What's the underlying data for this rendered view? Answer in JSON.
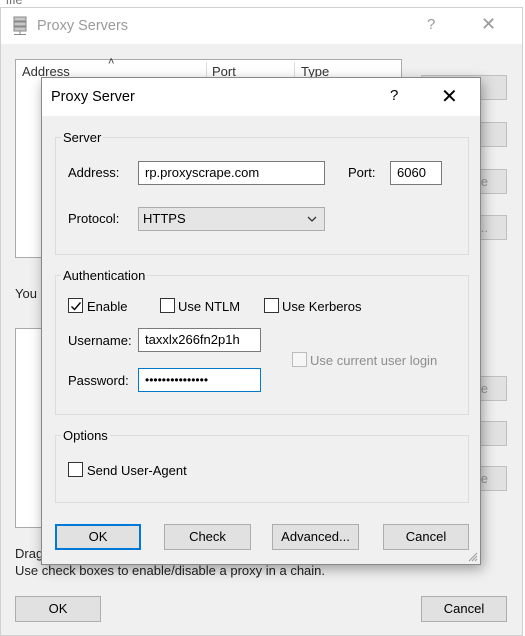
{
  "background": {
    "top_text": "ifie",
    "window": {
      "title": "Proxy Servers",
      "help_glyph": "?",
      "close_glyph": "✕",
      "columns": [
        "Address",
        "Port",
        "Type"
      ],
      "sort_glyph": "˄",
      "partial_text_you": "You c",
      "side_buttons": [
        "",
        "",
        "e",
        "..",
        "",
        "e",
        "",
        "e"
      ],
      "drag_text": "Drag",
      "hint_text": "Use check boxes to enable/disable a proxy in a chain.",
      "ok_label": "OK",
      "cancel_label": "Cancel"
    }
  },
  "dialog": {
    "title": "Proxy Server",
    "help_glyph": "?",
    "close_glyph": "✕",
    "server": {
      "group_label": "Server",
      "address_label": "Address:",
      "address_value": "rp.proxyscrape.com",
      "port_label": "Port:",
      "port_value": "6060",
      "protocol_label": "Protocol:",
      "protocol_value": "HTTPS"
    },
    "authentication": {
      "group_label": "Authentication",
      "enable_label": "Enable",
      "enable_checked": true,
      "ntlm_label": "Use NTLM",
      "kerberos_label": "Use Kerberos",
      "username_label": "Username:",
      "username_value": "taxxlx266fn2p1h",
      "current_user_label": "Use current user login",
      "password_label": "Password:",
      "password_value": "•••••••••••••••"
    },
    "options": {
      "group_label": "Options",
      "user_agent_label": "Send User-Agent"
    },
    "buttons": {
      "ok": "OK",
      "check": "Check",
      "advanced": "Advanced...",
      "cancel": "Cancel"
    }
  },
  "colors": {
    "accent": "#0078d7",
    "dialog_bg": "#f0f0f0",
    "button_bg": "#e1e1e1"
  }
}
